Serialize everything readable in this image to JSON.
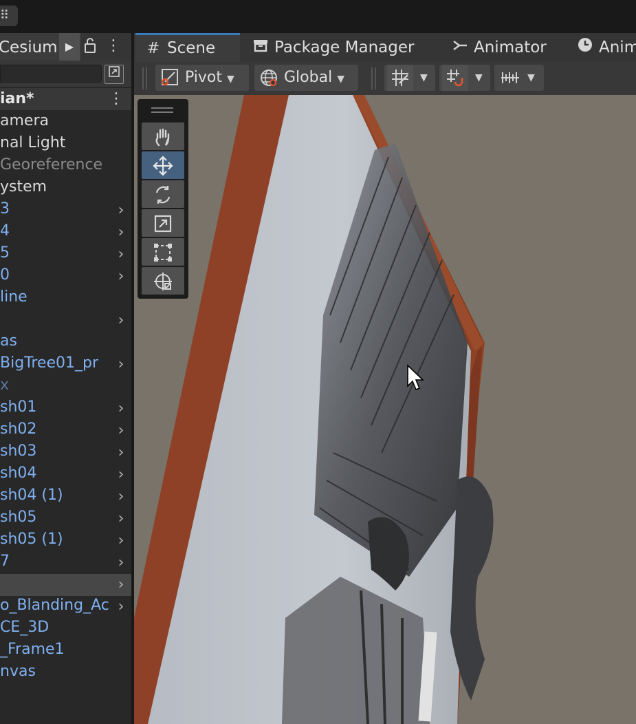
{
  "topbar": {
    "menu_icon": "grip-icon"
  },
  "hierarchy": {
    "tab_label": "Cesium",
    "scene_name": "ian*",
    "search_placeholder": "",
    "items": [
      {
        "label": "amera",
        "style": "normal",
        "arrow": false
      },
      {
        "label": "nal Light",
        "style": "normal",
        "arrow": false
      },
      {
        "label": "Georeference",
        "style": "faded",
        "arrow": false
      },
      {
        "label": "ystem",
        "style": "normal",
        "arrow": false
      },
      {
        "label": "3",
        "style": "blue",
        "arrow": true
      },
      {
        "label": "4",
        "style": "blue",
        "arrow": true
      },
      {
        "label": "5",
        "style": "blue",
        "arrow": true
      },
      {
        "label": "0",
        "style": "blue",
        "arrow": true
      },
      {
        "label": "line",
        "style": "blue",
        "arrow": false
      },
      {
        "label": "",
        "style": "blue",
        "arrow": true
      },
      {
        "label": "as",
        "style": "blue",
        "arrow": false
      },
      {
        "label": "BigTree01_pr",
        "style": "blue",
        "arrow": true
      },
      {
        "label": "x",
        "style": "fadedblue",
        "arrow": false
      },
      {
        "label": "sh01",
        "style": "blue",
        "arrow": true
      },
      {
        "label": "sh02",
        "style": "blue",
        "arrow": true
      },
      {
        "label": "sh03",
        "style": "blue",
        "arrow": true
      },
      {
        "label": "sh04",
        "style": "blue",
        "arrow": true
      },
      {
        "label": "sh04 (1)",
        "style": "blue",
        "arrow": true
      },
      {
        "label": "sh05",
        "style": "blue",
        "arrow": true
      },
      {
        "label": "sh05 (1)",
        "style": "blue",
        "arrow": true
      },
      {
        "label": "7",
        "style": "blue",
        "arrow": true
      },
      {
        "label": "",
        "style": "blue",
        "arrow": true,
        "selected": true
      },
      {
        "label": "o_Blanding_Ac",
        "style": "blue",
        "arrow": true
      },
      {
        "label": "CE_3D",
        "style": "blue",
        "arrow": false
      },
      {
        "label": "_Frame1",
        "style": "blue",
        "arrow": false
      },
      {
        "label": "nvas",
        "style": "blue",
        "arrow": false
      }
    ]
  },
  "scene_tabs": [
    {
      "label": "Scene",
      "icon": "grid-hash-icon",
      "active": true
    },
    {
      "label": "Package Manager",
      "icon": "package-icon",
      "active": false
    },
    {
      "label": "Animator",
      "icon": "animator-icon",
      "active": false
    },
    {
      "label": "Anim",
      "icon": "clock-icon",
      "active": false
    }
  ],
  "toolbar": {
    "pivot_label": "Pivot",
    "global_label": "Global"
  },
  "tools": [
    "hand-tool",
    "move-tool",
    "rotate-tool",
    "scale-tool",
    "rect-tool",
    "transform-tool"
  ],
  "active_tool": "move-tool",
  "colors": {
    "accent": "#3a79bb",
    "selected_tool": "#46607f",
    "viewport_bg": "#7a736a",
    "frame_wood": "#8a3f26",
    "prefab_blue": "#7fb0f0"
  }
}
